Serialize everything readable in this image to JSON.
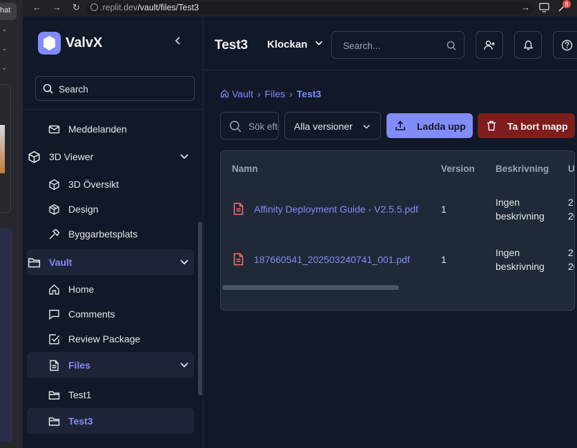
{
  "browser": {
    "url_domain": ".replit.dev",
    "url_path": "/vault/files/Test3",
    "left_tab_label": "hat",
    "notification_count": "8"
  },
  "sidebar": {
    "brand": "ValvX",
    "search_label": "Search",
    "items": [
      {
        "label": "Meddelanden",
        "icon": "mail-icon"
      },
      {
        "label": "3D Viewer",
        "icon": "cube-icon",
        "expandable": true
      },
      {
        "label": "3D Översikt",
        "icon": "cube-icon"
      },
      {
        "label": "Design",
        "icon": "package-icon"
      },
      {
        "label": "Byggarbetsplats",
        "icon": "hammer-icon"
      },
      {
        "label": "Vault",
        "icon": "folder-icon",
        "expandable": true,
        "active": true
      },
      {
        "label": "Home",
        "icon": "home-icon"
      },
      {
        "label": "Comments",
        "icon": "comment-icon"
      },
      {
        "label": "Review Package",
        "icon": "checkbox-icon"
      },
      {
        "label": "Files",
        "icon": "file-icon",
        "expandable": true,
        "active": true
      },
      {
        "label": "Test1",
        "icon": "folder-icon"
      },
      {
        "label": "Test3",
        "icon": "folder-icon",
        "active": true
      }
    ]
  },
  "header": {
    "title": "Test3",
    "org_name": "Klockan",
    "search_placeholder": "Search..."
  },
  "breadcrumb": [
    "Vault",
    "Files",
    "Test3"
  ],
  "toolbar": {
    "search_placeholder": "Sök efter filer...",
    "version_filter": "Alla versioner",
    "upload_label": "Ladda upp",
    "delete_label": "Ta bort mapp"
  },
  "table": {
    "columns": [
      "Namn",
      "Version",
      "Beskrivning",
      "U"
    ],
    "rows": [
      {
        "name": "Affinity Deployment Guide - V2.5.5.pdf",
        "version": "1",
        "desc_line1": "Ingen",
        "desc_line2": "beskrivning",
        "extra_line1": "2",
        "extra_line2": "20"
      },
      {
        "name": "187660541_202503240741_001.pdf",
        "version": "1",
        "desc_line1": "Ingen",
        "desc_line2": "beskrivning",
        "extra_line1": "2",
        "extra_line2": "20"
      }
    ]
  },
  "colors": {
    "accent": "#818cf8",
    "danger": "#7f1d1d",
    "pdf_icon": "#f87171",
    "background": "#111827"
  }
}
